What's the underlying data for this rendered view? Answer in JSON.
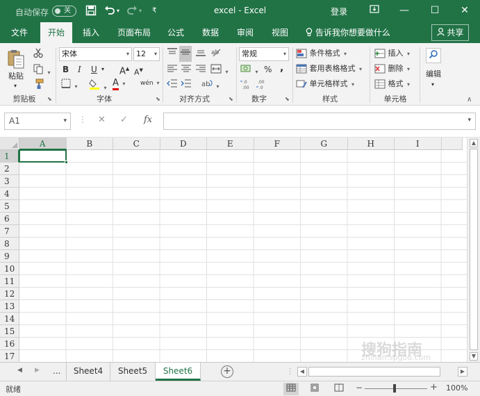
{
  "window": {
    "autosave_label": "自动保存",
    "autosave_state": "关",
    "title": "excel  -  Excel",
    "login": "登录"
  },
  "icons": {
    "save": "save-icon",
    "undo": "undo-icon",
    "redo": "redo-icon",
    "ribbon_display": "ribbon-display-icon",
    "minimize": "minimize-icon",
    "maximize": "maximize-icon",
    "close": "close-icon"
  },
  "ribbon_tabs": [
    {
      "label": "文件"
    },
    {
      "label": "开始"
    },
    {
      "label": "插入"
    },
    {
      "label": "页面布局"
    },
    {
      "label": "公式"
    },
    {
      "label": "数据"
    },
    {
      "label": "审阅"
    },
    {
      "label": "视图"
    }
  ],
  "tell_me": "告诉我你想要做什么",
  "share": "共享",
  "ribbon": {
    "clipboard": {
      "label": "剪贴板",
      "paste": "粘贴"
    },
    "font": {
      "label": "字体",
      "name": "宋体",
      "size": "12",
      "bold": "B",
      "italic": "I",
      "underline": "U",
      "grow": "A",
      "shrink": "A",
      "font_color": "A",
      "phonetic": "wén"
    },
    "alignment": {
      "label": "对齐方式"
    },
    "number": {
      "label": "数字",
      "format": "常规",
      "percent": "%",
      "comma": ","
    },
    "styles": {
      "label": "样式",
      "conditional": "条件格式",
      "table": "套用表格格式",
      "cell_styles": "单元格样式"
    },
    "cells": {
      "label": "单元格",
      "insert": "插入",
      "delete": "删除",
      "format": "格式"
    },
    "editing": {
      "label": "编辑"
    }
  },
  "formula_bar": {
    "name_box": "A1",
    "fx": "fx",
    "formula": ""
  },
  "grid": {
    "columns": [
      "A",
      "B",
      "C",
      "D",
      "E",
      "F",
      "G",
      "H",
      "I"
    ],
    "rows": [
      "1",
      "2",
      "3",
      "4",
      "5",
      "6",
      "7",
      "8",
      "9",
      "10",
      "11",
      "12",
      "13",
      "14",
      "15",
      "16",
      "17"
    ],
    "active_cell": "A1"
  },
  "sheets": {
    "more": "...",
    "tabs": [
      "Sheet4",
      "Sheet5",
      "Sheet6"
    ],
    "active": "Sheet6"
  },
  "status": {
    "ready": "就绪",
    "zoom": "100%"
  },
  "watermark": {
    "text": "搜狗指南",
    "sub": "zhinan.sogou.com"
  },
  "colors": {
    "accent": "#217346"
  }
}
